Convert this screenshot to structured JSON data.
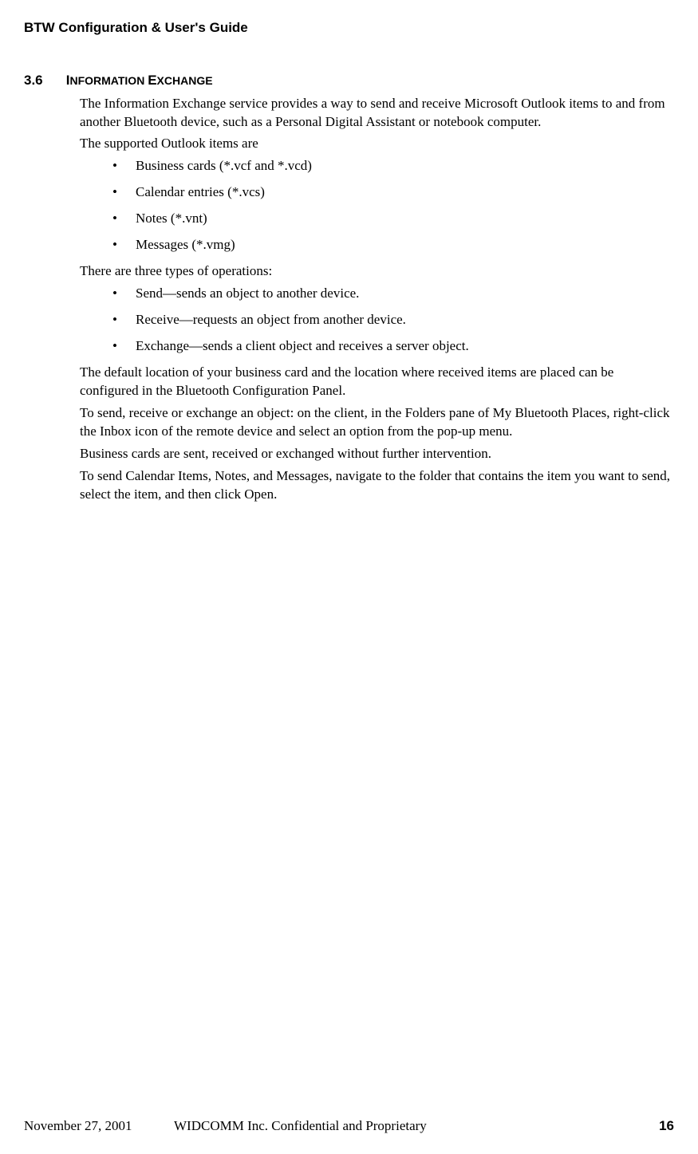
{
  "header": {
    "title": "BTW Configuration & User's Guide"
  },
  "section": {
    "number": "3.6",
    "title_prefix": "I",
    "title_rest": "NFORMATION ",
    "title_prefix2": "E",
    "title_rest2": "XCHANGE"
  },
  "paragraphs": {
    "p1": "The Information Exchange service provides a way to send and receive Microsoft Outlook items to and from another Bluetooth device, such as a Personal Digital Assistant or notebook computer.",
    "p2": "The supported Outlook items are",
    "supported_items": [
      "Business cards (*.vcf and *.vcd)",
      "Calendar entries (*.vcs)",
      "Notes (*.vnt)",
      "Messages (*.vmg)"
    ],
    "p3": "There are three types of operations:",
    "operations": [
      "Send—sends an object to another device.",
      "Receive—requests an object from another device.",
      "Exchange—sends a client object and receives a server object."
    ],
    "p4": "The default location of your business card and the location where received items are placed can be configured in the Bluetooth Configuration Panel.",
    "p5": "To send, receive or exchange an object: on the client, in the Folders pane of My Bluetooth Places, right-click the Inbox icon of the remote device and select an option from the pop-up menu.",
    "p6": "Business cards are sent, received or exchanged without further intervention.",
    "p7": "To send Calendar Items, Notes, and Messages, navigate to the folder that contains the item you want to send, select the item, and then click Open."
  },
  "footer": {
    "date": "November 27, 2001",
    "confidential": "WIDCOMM Inc. Confidential and Proprietary",
    "page": "16"
  }
}
